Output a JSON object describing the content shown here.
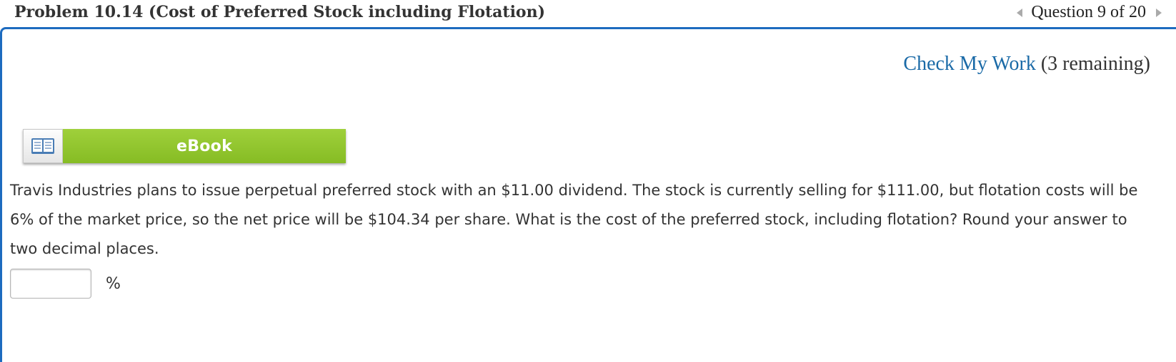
{
  "header": {
    "title": "Problem 10.14 (Cost of Preferred Stock including Flotation)",
    "question_nav": "Question 9 of 20",
    "prev_icon": "chevron-left-icon",
    "next_icon": "chevron-right-icon"
  },
  "check_work": {
    "link_label": "Check My Work",
    "remaining": "(3 remaining)"
  },
  "ebook": {
    "label": "eBook",
    "icon": "book-icon",
    "color": "#8cc63f"
  },
  "question": {
    "text": "Travis Industries plans to issue perpetual preferred stock with an $11.00 dividend. The stock is currently selling for $111.00, but flotation costs will be 6% of the market price, so the net price will be $104.34 per share. What is the cost of the preferred stock, including flotation? Round your answer to two decimal places."
  },
  "answer": {
    "value": "",
    "unit": "%"
  },
  "colors": {
    "panel_border": "#1d6bbf",
    "link": "#1a6aa7"
  }
}
